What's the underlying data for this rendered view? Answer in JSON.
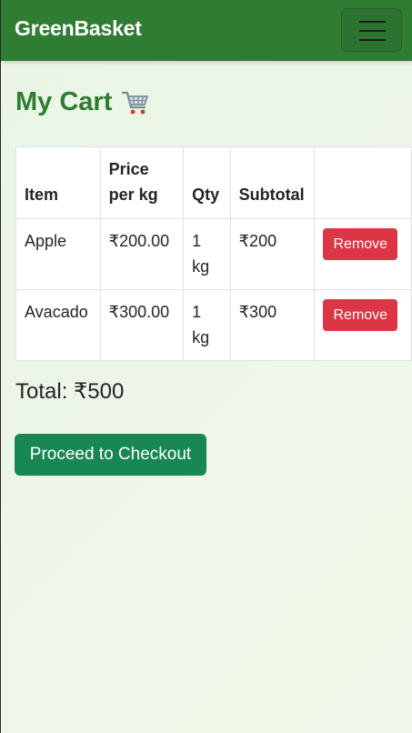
{
  "navbar": {
    "brand": "GreenBasket",
    "toggler_icon": "hamburger-menu-icon"
  },
  "page": {
    "title": "My Cart",
    "title_icon": "shopping-cart-icon"
  },
  "table": {
    "headers": {
      "item": "Item",
      "price_line1": "Price",
      "price_line2": "per kg",
      "qty": "Qty",
      "subtotal": "Subtotal",
      "action": ""
    },
    "rows": [
      {
        "item": "Apple",
        "price": "₹200.00",
        "qty_line1": "1",
        "qty_line2": "kg",
        "subtotal": "₹200",
        "action_label": "Remove"
      },
      {
        "item": "Avacado",
        "price": "₹300.00",
        "qty_line1": "1",
        "qty_line2": "kg",
        "subtotal": "₹300",
        "action_label": "Remove"
      }
    ]
  },
  "summary": {
    "total_text": "Total: ₹500"
  },
  "checkout": {
    "label": "Proceed to Checkout"
  },
  "colors": {
    "navbar": "#2f7d32",
    "title": "#2e7d32",
    "remove": "#dc3545",
    "checkout": "#198754"
  }
}
